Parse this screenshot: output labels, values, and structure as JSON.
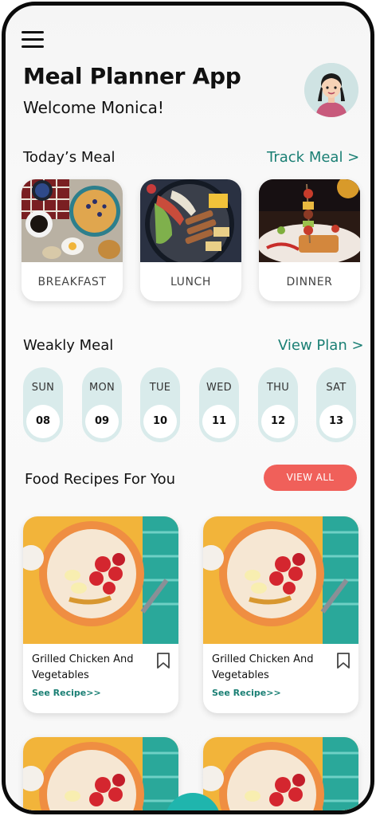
{
  "header": {
    "title": "Meal Planner App",
    "welcome": "Welcome Monica!"
  },
  "today": {
    "title": "Today’s Meal",
    "link": "Track Meal >",
    "meals": [
      {
        "label": "BREAKFAST",
        "image": "breakfast-photo"
      },
      {
        "label": "LUNCH",
        "image": "lunch-photo"
      },
      {
        "label": "DINNER",
        "image": "dinner-photo"
      }
    ]
  },
  "weekly": {
    "title": "Weakly Meal",
    "link": "View Plan >",
    "days": [
      {
        "name": "SUN",
        "num": "08"
      },
      {
        "name": "MON",
        "num": "09"
      },
      {
        "name": "TUE",
        "num": "10"
      },
      {
        "name": "WED",
        "num": "11"
      },
      {
        "name": "THU",
        "num": "12"
      },
      {
        "name": "SAT",
        "num": "13"
      }
    ]
  },
  "recipes": {
    "title": "Food Recipes For You",
    "view_all": "VIEW ALL",
    "items": [
      {
        "name": "Grilled Chicken And Vegetables",
        "link": "See Recipe>>"
      },
      {
        "name": "Grilled Chicken And Vegetables",
        "link": "See Recipe>>"
      }
    ]
  },
  "colors": {
    "accent": "#1a7f74",
    "button": "#f0605a",
    "day_pill": "#d9ebeb"
  },
  "icons": [
    "menu-icon",
    "bookmark-icon",
    "avatar-icon"
  ]
}
